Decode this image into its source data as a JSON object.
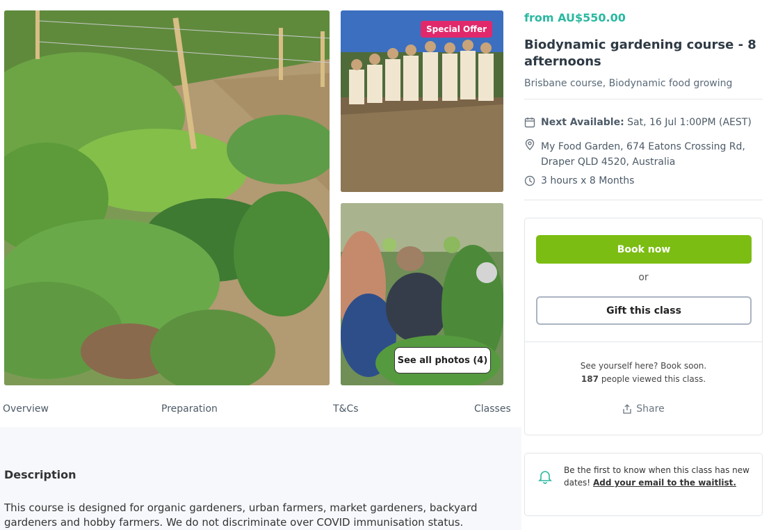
{
  "gallery": {
    "badge": "Special Offer",
    "see_all": "See all photos (4)"
  },
  "tabs": [
    "Overview",
    "Preparation",
    "T&Cs",
    "Classes"
  ],
  "description": {
    "title": "Description",
    "text": "This course is designed for organic gardeners, urban farmers, market gardeners, backyard gardeners and hobby farmers. We do not discriminate over COVID immunisation status."
  },
  "course": {
    "price": "from AU$550.00",
    "title": "Biodynamic gardening course - 8 afternoons",
    "categories": "Brisbane course, Biodynamic food growing",
    "next_label": "Next Available:",
    "next_value": "Sat, 16 Jul 1:00PM (AEST)",
    "location": "My Food Garden, 674 Eatons Crossing Rd, Draper QLD 4520, Australia",
    "duration": "3 hours x 8 Months"
  },
  "booking": {
    "book_label": "Book now",
    "or_label": "or",
    "gift_label": "Gift this class",
    "see_yourself": "See yourself here? Book soon.",
    "viewed_count": "187",
    "viewed_suffix": "people viewed this class.",
    "share_label": "Share"
  },
  "notify": {
    "text": "Be the first to know when this class has new dates!",
    "link": "Add your email to the waitlist."
  },
  "colors": {
    "accent": "#2bb8a0",
    "book_button": "#7bbd12",
    "badge": "#e1286b"
  }
}
